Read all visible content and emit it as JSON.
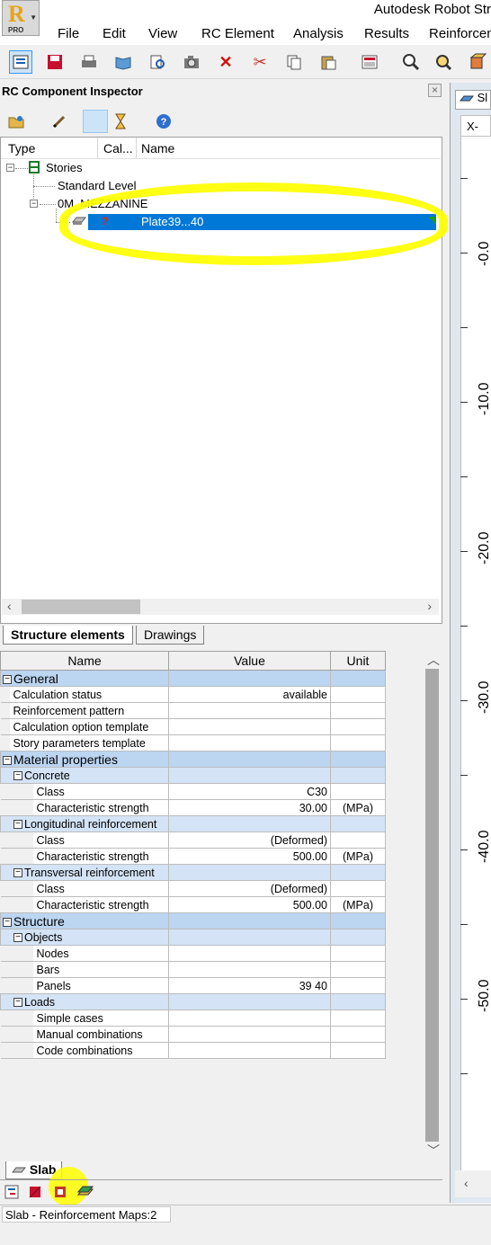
{
  "app": {
    "title": "Autodesk Robot Str",
    "logo_letter": "R",
    "logo_edition": "PRO"
  },
  "menu": [
    "File",
    "Edit",
    "View",
    "RC Element",
    "Analysis",
    "Results",
    "Reinforcem"
  ],
  "inspector": {
    "title": "RC Component Inspector",
    "close_glyph": "×",
    "columns": {
      "type": "Type",
      "cal": "Cal...",
      "name": "Name"
    },
    "tree": {
      "root": "Stories",
      "level1": "Standard Level",
      "level2": "0M_MEZZANINE",
      "element_calc": "?",
      "element_name": "Plate39...40"
    },
    "tabs": {
      "structure": "Structure elements",
      "drawings": "Drawings"
    }
  },
  "grid": {
    "headers": {
      "name": "Name",
      "value": "Value",
      "unit": "Unit"
    },
    "rows": [
      {
        "kind": "sec",
        "indent": 0,
        "expander": "−",
        "name": "General",
        "value": "",
        "unit": ""
      },
      {
        "kind": "item",
        "indent": 1,
        "name": "Calculation status",
        "value": "available",
        "unit": ""
      },
      {
        "kind": "item",
        "indent": 1,
        "name": "Reinforcement pattern",
        "value": "",
        "unit": ""
      },
      {
        "kind": "item",
        "indent": 1,
        "name": "Calculation option template",
        "value": "",
        "unit": ""
      },
      {
        "kind": "item",
        "indent": 1,
        "name": "Story parameters template",
        "value": "",
        "unit": ""
      },
      {
        "kind": "sec",
        "indent": 0,
        "expander": "−",
        "name": "Material properties",
        "value": "",
        "unit": ""
      },
      {
        "kind": "sub",
        "indent": 1,
        "expander": "−",
        "name": "Concrete",
        "value": "",
        "unit": ""
      },
      {
        "kind": "item",
        "indent": 2,
        "name": "Class",
        "value": "C30",
        "unit": ""
      },
      {
        "kind": "item",
        "indent": 2,
        "name": "Characteristic strength",
        "value": "30.00",
        "unit": "(MPa)"
      },
      {
        "kind": "sub",
        "indent": 1,
        "expander": "−",
        "name": "Longitudinal reinforcement",
        "value": "",
        "unit": ""
      },
      {
        "kind": "item",
        "indent": 2,
        "name": "Class",
        "value": "(Deformed)",
        "unit": ""
      },
      {
        "kind": "item",
        "indent": 2,
        "name": "Characteristic strength",
        "value": "500.00",
        "unit": "(MPa)"
      },
      {
        "kind": "sub",
        "indent": 1,
        "expander": "−",
        "name": "Transversal reinforcement",
        "value": "",
        "unit": ""
      },
      {
        "kind": "item",
        "indent": 2,
        "name": "Class",
        "value": "(Deformed)",
        "unit": ""
      },
      {
        "kind": "item",
        "indent": 2,
        "name": "Characteristic strength",
        "value": "500.00",
        "unit": "(MPa)"
      },
      {
        "kind": "sec",
        "indent": 0,
        "expander": "−",
        "name": "Structure",
        "value": "",
        "unit": ""
      },
      {
        "kind": "sub",
        "indent": 1,
        "expander": "−",
        "name": "Objects",
        "value": "",
        "unit": ""
      },
      {
        "kind": "item",
        "indent": 2,
        "name": "Nodes",
        "value": "",
        "unit": ""
      },
      {
        "kind": "item",
        "indent": 2,
        "name": "Bars",
        "value": "",
        "unit": ""
      },
      {
        "kind": "item",
        "indent": 2,
        "name": "Panels",
        "value": "39 40",
        "unit": ""
      },
      {
        "kind": "sub",
        "indent": 1,
        "expander": "−",
        "name": "Loads",
        "value": "",
        "unit": ""
      },
      {
        "kind": "item",
        "indent": 2,
        "name": "Simple cases",
        "value": "",
        "unit": ""
      },
      {
        "kind": "item",
        "indent": 2,
        "name": "Manual combinations",
        "value": "",
        "unit": ""
      },
      {
        "kind": "item",
        "indent": 2,
        "name": "Code combinations",
        "value": "",
        "unit": ""
      }
    ]
  },
  "bottom": {
    "slab_tab": "Slab",
    "status": "Slab - Reinforcement Maps:2"
  },
  "view": {
    "tab_label": "Sl",
    "x_label": "X-",
    "axis_labels": [
      "-0.0",
      "-10.0",
      "-20.0",
      "-30.0",
      "-40.0",
      "-50.0"
    ]
  },
  "colors": {
    "selection": "#0078d7",
    "annotation_highlight": "#ffff00",
    "section_row": "#bcd5f1",
    "subsection_row": "#d4e3f6"
  }
}
